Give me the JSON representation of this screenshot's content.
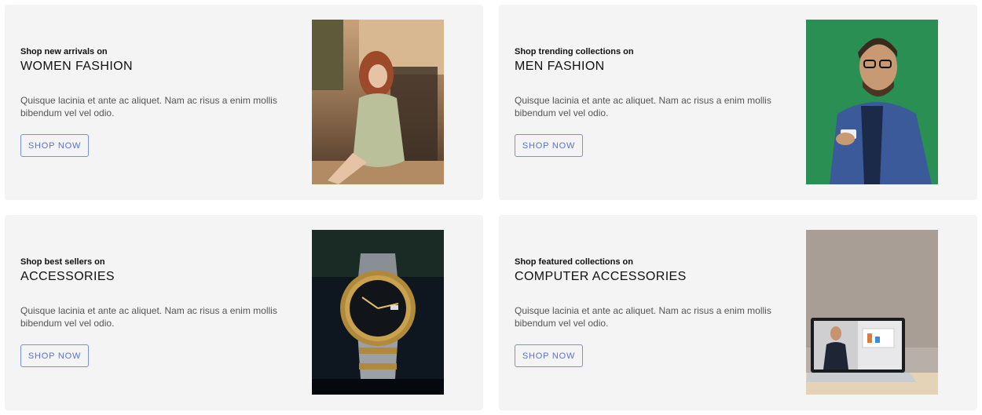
{
  "cards": [
    {
      "kicker": "Shop new arrivals on",
      "title": "WOMEN FASHION",
      "description": "Quisque lacinia et ante ac aliquet. Nam ac risus a enim mollis bibendum vel vel odio.",
      "button_label": "SHOP NOW",
      "image": "woman-in-floral-dress-photo"
    },
    {
      "kicker": "Shop trending collections on",
      "title": "MEN FASHION",
      "description": "Quisque lacinia et ante ac aliquet. Nam ac risus a enim mollis bibendum vel vel odio.",
      "button_label": "SHOP NOW",
      "image": "man-with-phone-photo"
    },
    {
      "kicker": "Shop best sellers on",
      "title": "ACCESSORIES",
      "description": "Quisque lacinia et ante ac aliquet. Nam ac risus a enim mollis bibendum vel vel odio.",
      "button_label": "SHOP NOW",
      "image": "wristwatch-photo"
    },
    {
      "kicker": "Shop featured collections on",
      "title": "COMPUTER ACCESSORIES",
      "description": "Quisque lacinia et ante ac aliquet. Nam ac risus a enim mollis bibendum vel vel odio.",
      "button_label": "SHOP NOW",
      "image": "laptop-video-call-photo"
    }
  ],
  "colors": {
    "card_background": "#f4f4f4",
    "button_border": "#7b8ee0",
    "button_text": "#5a70d6",
    "title_text": "#111111",
    "body_text": "#555555"
  }
}
